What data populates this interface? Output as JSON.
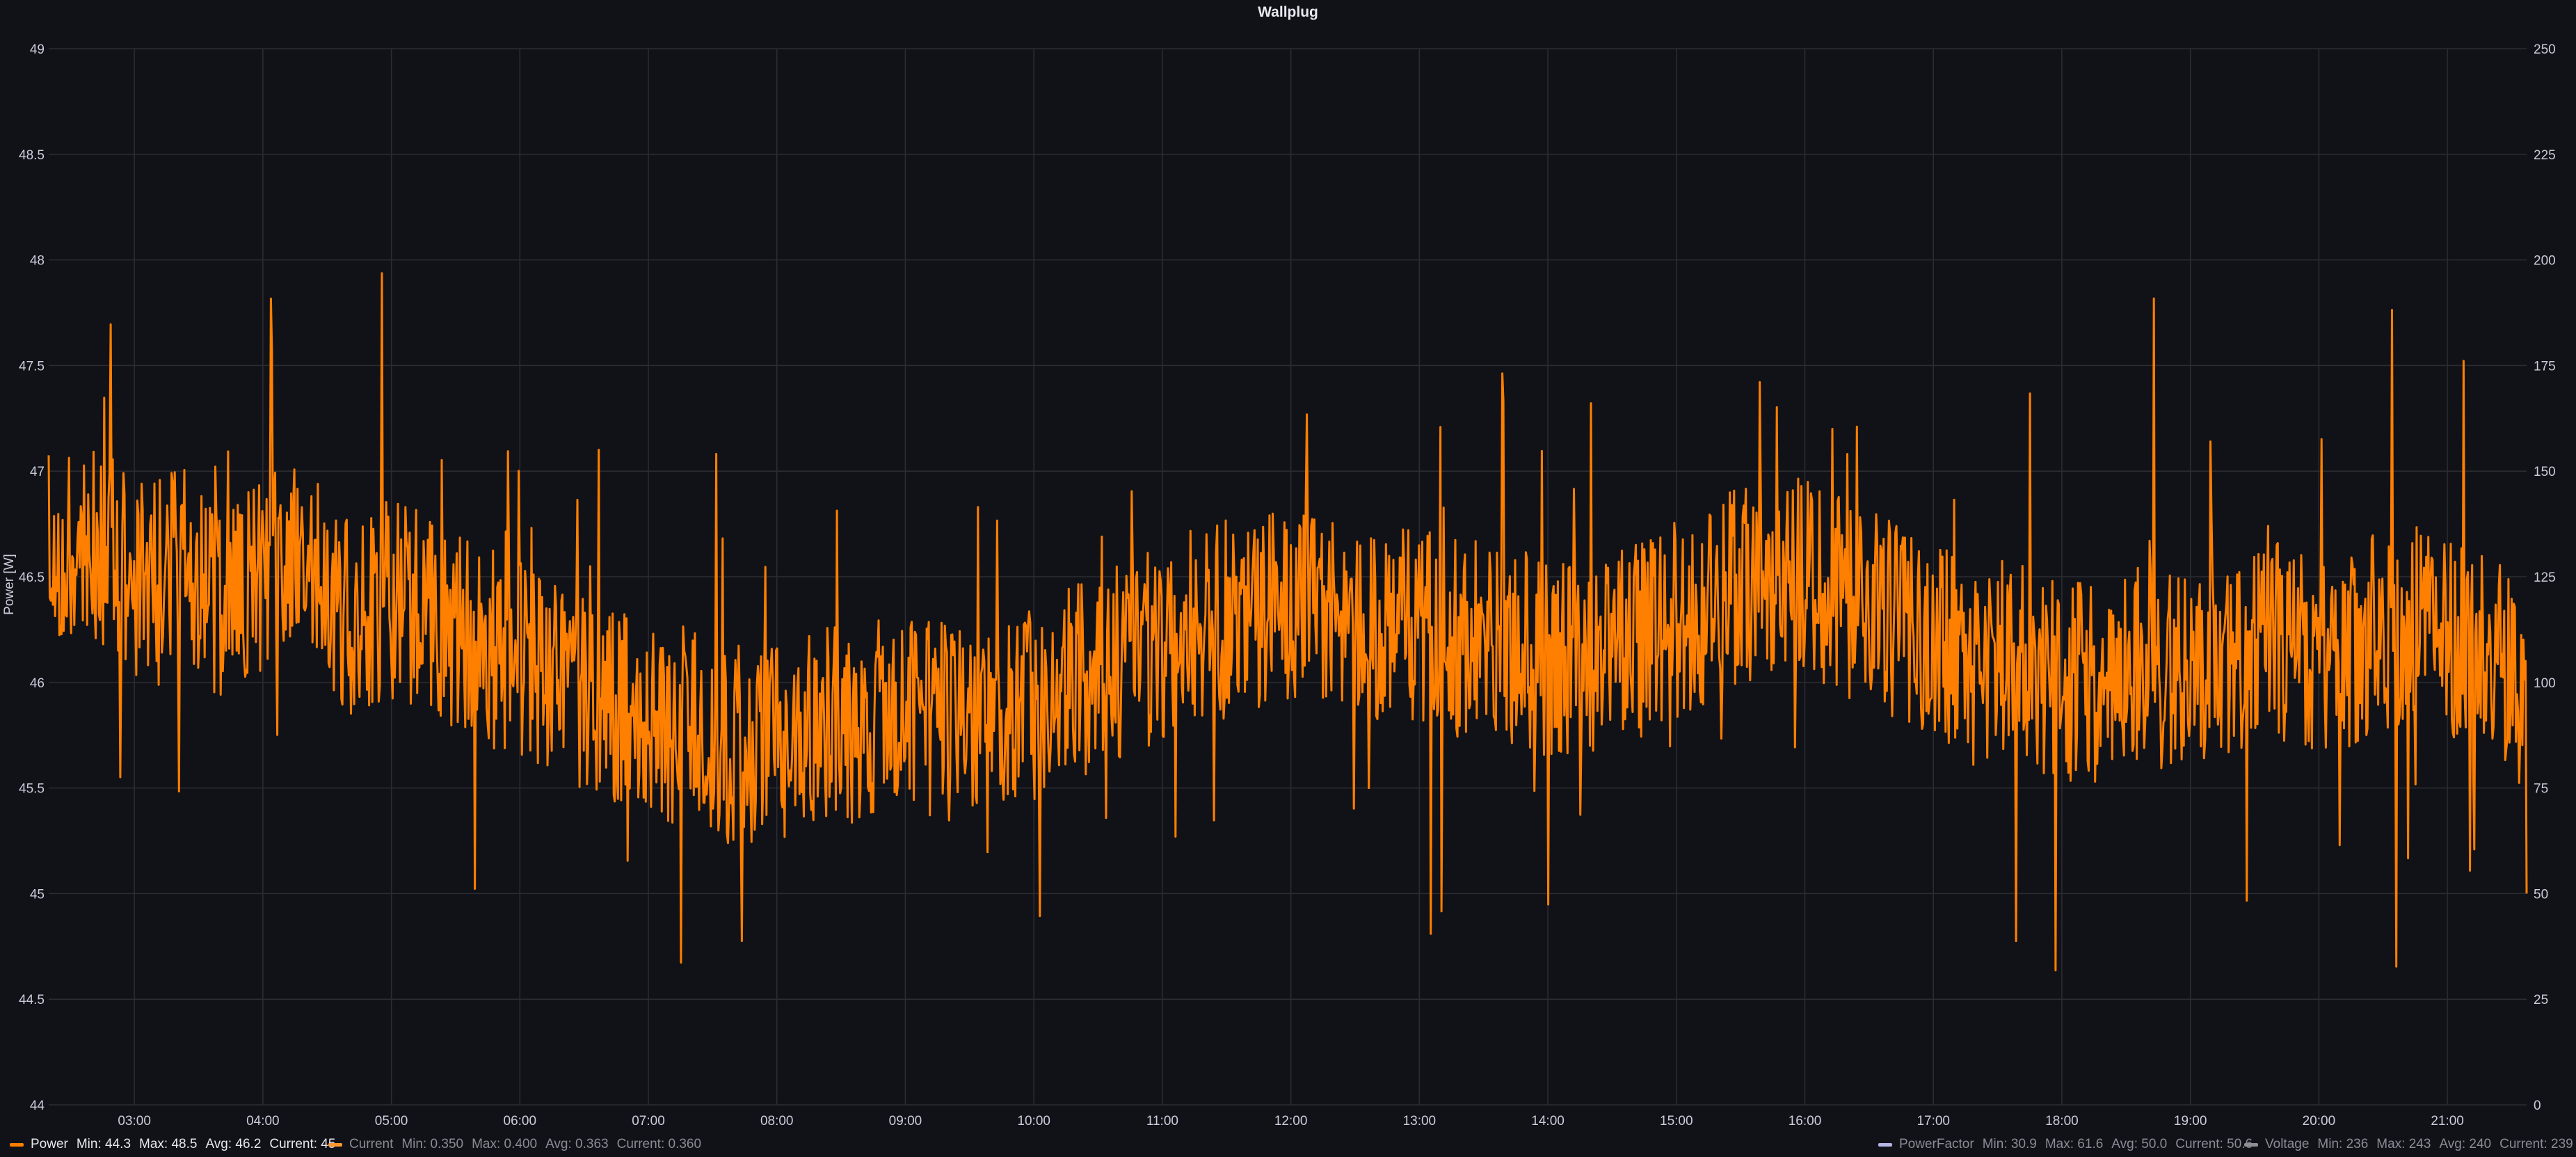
{
  "panel": {
    "title": "Wallplug"
  },
  "colors": {
    "background": "#111217",
    "grid": "#2c2d33",
    "power": "#ff7f00",
    "current": "#ff9830",
    "powerfactor": "#b4b6e6",
    "voltage": "#8e8f96"
  },
  "chart_data": {
    "type": "line",
    "title": "Wallplug",
    "xlabel": "",
    "ylabel": "Power [W]",
    "ylim": [
      44,
      49
    ],
    "y_ticks": [
      "49",
      "48.5",
      "48",
      "47.5",
      "47",
      "46.5",
      "46",
      "45.5",
      "45",
      "44.5",
      "44"
    ],
    "y2lim": [
      0,
      250
    ],
    "y2_ticks": [
      "250",
      "225",
      "200",
      "175",
      "150",
      "125",
      "100",
      "75",
      "50",
      "25",
      "0"
    ],
    "x_range": [
      "02:20",
      "21:37"
    ],
    "x_ticks": [
      "03:00",
      "04:00",
      "05:00",
      "06:00",
      "07:00",
      "08:00",
      "09:00",
      "10:00",
      "11:00",
      "12:00",
      "13:00",
      "14:00",
      "15:00",
      "16:00",
      "17:00",
      "18:00",
      "19:00",
      "20:00",
      "21:00"
    ],
    "grid": true,
    "legend_position": "bottom",
    "series": [
      {
        "name": "Power",
        "axis": "left",
        "x": [
          "02:20",
          "02:40",
          "03:00",
          "03:20",
          "03:40",
          "04:00",
          "04:20",
          "04:40",
          "05:00",
          "05:20",
          "05:40",
          "06:00",
          "06:20",
          "06:40",
          "07:00",
          "07:20",
          "07:40",
          "08:00",
          "08:20",
          "08:40",
          "09:00",
          "09:20",
          "09:40",
          "10:00",
          "10:20",
          "10:40",
          "11:00",
          "11:20",
          "11:40",
          "12:00",
          "12:20",
          "12:40",
          "13:00",
          "13:20",
          "13:40",
          "14:00",
          "14:20",
          "14:40",
          "15:00",
          "15:20",
          "15:40",
          "16:00",
          "16:20",
          "16:40",
          "17:00",
          "17:20",
          "17:40",
          "18:00",
          "18:20",
          "18:40",
          "19:00",
          "19:20",
          "19:40",
          "20:00",
          "20:20",
          "20:40",
          "21:00",
          "21:20",
          "21:37"
        ],
        "y": [
          46.6,
          46.7,
          46.5,
          46.6,
          46.4,
          46.5,
          46.6,
          46.3,
          46.4,
          46.3,
          46.2,
          46.1,
          46.0,
          45.9,
          45.8,
          45.8,
          45.7,
          45.7,
          45.8,
          45.8,
          45.9,
          45.8,
          45.8,
          45.9,
          46.0,
          46.1,
          46.2,
          46.3,
          46.3,
          46.4,
          46.4,
          46.3,
          46.3,
          46.2,
          46.2,
          46.1,
          46.1,
          46.2,
          46.3,
          46.4,
          46.5,
          46.5,
          46.4,
          46.3,
          46.2,
          46.1,
          46.1,
          46.0,
          46.0,
          46.1,
          46.0,
          46.1,
          46.2,
          46.1,
          46.2,
          46.3,
          46.2,
          46.2,
          45.9
        ],
        "min": "44.3",
        "max": "48.5",
        "avg": "46.2",
        "current": "45"
      }
    ]
  },
  "legend": {
    "items": [
      {
        "name": "Power",
        "min_label": "Min: 44.3",
        "max_label": "Max: 48.5",
        "avg_label": "Avg: 46.2",
        "current_label": "Current: 45"
      },
      {
        "name": "Current",
        "min_label": "Min: 0.350",
        "max_label": "Max: 0.400",
        "avg_label": "Avg: 0.363",
        "current_label": "Current: 0.360"
      },
      {
        "name": "PowerFactor",
        "min_label": "Min: 30.9",
        "max_label": "Max: 61.6",
        "avg_label": "Avg: 50.0",
        "current_label": "Current: 50.6"
      },
      {
        "name": "Voltage",
        "min_label": "Min: 236",
        "max_label": "Max: 243",
        "avg_label": "Avg: 240",
        "current_label": "Current: 239"
      }
    ]
  }
}
